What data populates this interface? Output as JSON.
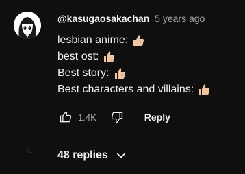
{
  "comment": {
    "author": "@kasugaosakachan",
    "timestamp": "5 years ago",
    "lines": [
      {
        "text": "lesbian anime:",
        "emoji": "thumbs-up-emoji"
      },
      {
        "text": "best ost:",
        "emoji": "thumbs-up-emoji"
      },
      {
        "text": "Best story:",
        "emoji": "thumbs-up-emoji"
      },
      {
        "text": "Best characters and villains:",
        "emoji": "thumbs-up-emoji"
      }
    ],
    "actions": {
      "like_count": "1.4K",
      "reply_label": "Reply"
    },
    "replies_label": "48 replies"
  },
  "colors": {
    "background": "#0f0f0f",
    "text_primary": "#f1f1f1",
    "text_secondary": "#aaaaaa",
    "emoji_skin": "#f3c9a4"
  },
  "icons": [
    "avatar-anime-girl",
    "thumbs-up-emoji",
    "like-icon",
    "dislike-icon",
    "chevron-down-icon"
  ]
}
